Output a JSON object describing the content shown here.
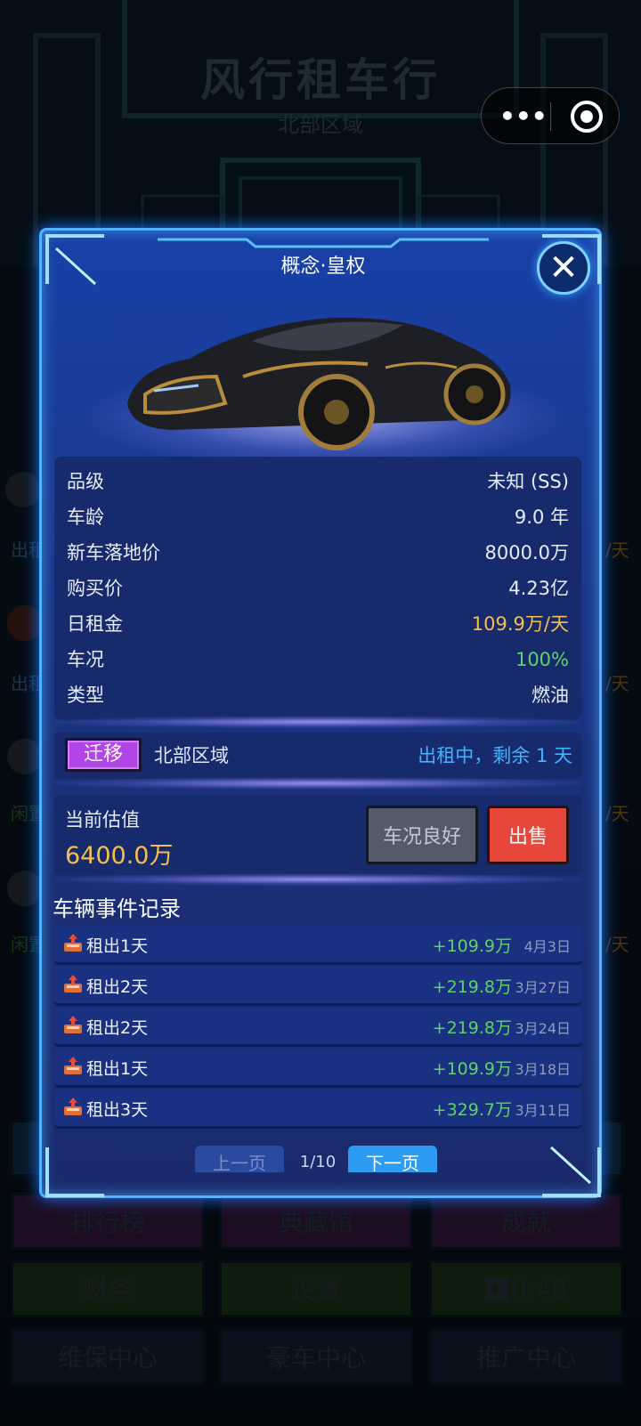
{
  "background": {
    "title": "风行租车行",
    "subtitle": "北部区域",
    "side_labels": [
      "出租",
      "/天",
      "出租",
      "/天",
      "闲置",
      "/天",
      "闲置",
      "/天"
    ],
    "buttons": [
      "排行榜",
      "典藏馆",
      "成就",
      "财务",
      "设置",
      "0:48",
      "维保中心",
      "豪车中心",
      "推广中心"
    ]
  },
  "mini_program": {
    "menu_icon": "more-dots-icon",
    "close_icon": "target-icon"
  },
  "modal": {
    "title": "概念·皇权",
    "close_label": "✕",
    "stats": [
      {
        "key": "品级",
        "value": "未知 (SS)",
        "color": "#e8ecf7"
      },
      {
        "key": "车龄",
        "value": "9.0 年",
        "color": "#e8ecf7"
      },
      {
        "key": "新车落地价",
        "value": "8000.0万",
        "color": "#e8ecf7"
      },
      {
        "key": "购买价",
        "value": "4.23亿",
        "color": "#e8ecf7"
      },
      {
        "key": "日租金",
        "value": "109.9万/天",
        "color": "#f5c04d"
      },
      {
        "key": "车况",
        "value": "100%",
        "color": "#5fd36a"
      },
      {
        "key": "类型",
        "value": "燃油",
        "color": "#e8ecf7"
      }
    ],
    "region": {
      "migrate_label": "迁移",
      "name": "北部区域",
      "status": "出租中，剩余 1 天"
    },
    "valuation": {
      "label": "当前估值",
      "amount": "6400.0万",
      "condition_label": "车况良好",
      "sell_label": "出售"
    },
    "events_title": "车辆事件记录",
    "events": [
      {
        "label": "租出1天",
        "amount": "+109.9万",
        "date": "4月3日"
      },
      {
        "label": "租出2天",
        "amount": "+219.8万",
        "date": "3月27日"
      },
      {
        "label": "租出2天",
        "amount": "+219.8万",
        "date": "3月24日"
      },
      {
        "label": "租出1天",
        "amount": "+109.9万",
        "date": "3月18日"
      },
      {
        "label": "租出3天",
        "amount": "+329.7万",
        "date": "3月11日"
      }
    ],
    "pager": {
      "prev_label": "上一页",
      "page_info": "1/10",
      "next_label": "下一页"
    }
  },
  "colors": {
    "accent": "#2d9bf2",
    "gold": "#f5c04d",
    "green": "#5fd36a",
    "sell": "#e7473a",
    "migrate": "#b245e8"
  }
}
